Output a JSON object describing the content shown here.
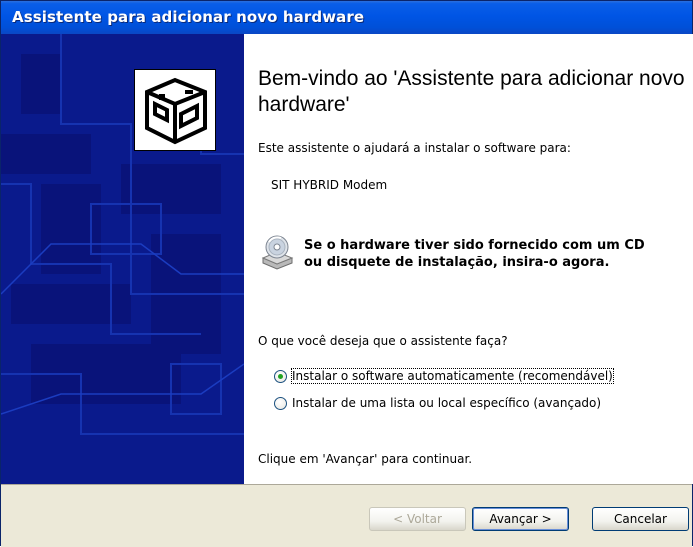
{
  "window": {
    "title": "Assistente para adicionar novo hardware"
  },
  "main": {
    "heading": "Bem-vindo ao 'Assistente para adicionar novo hardware'",
    "intro": "Este assistente o ajudará a instalar o software para:",
    "device_name": "SIT HYBRID Modem",
    "cd_prompt_line1": "Se o hardware tiver sido fornecido com um CD",
    "cd_prompt_line2": "ou disquete de instalação, insira-o agora.",
    "question": "O que você deseja que o assistente faça?",
    "options": [
      {
        "label": "Instalar o software automaticamente (recomendável)",
        "selected": true
      },
      {
        "label": "Instalar de uma lista ou local específico (avançado)",
        "selected": false
      }
    ],
    "continue_text": "Clique em 'Avançar' para continuar."
  },
  "buttons": {
    "back": "< Voltar",
    "next": "Avançar >",
    "cancel": "Cancelar"
  },
  "icons": {
    "wizard": "hardware-wizard-icon",
    "cd": "cd-drive-icon"
  },
  "colors": {
    "title_bar": "#0055e5",
    "side_panel": "#0a1a8c",
    "dialog_bg": "#ece9d8"
  }
}
